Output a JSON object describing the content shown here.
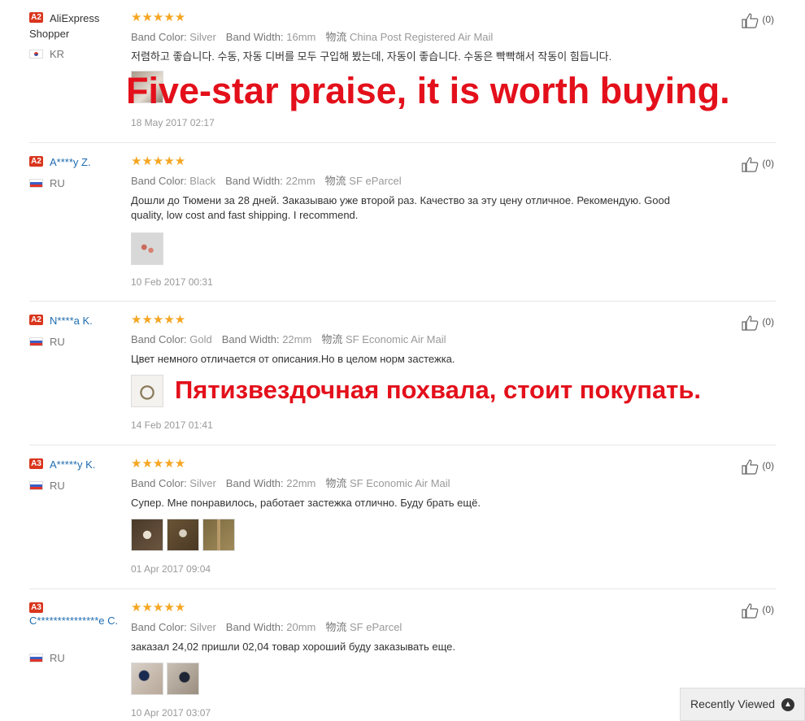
{
  "reviews": [
    {
      "level": "A2",
      "user": "AliExpress Shopper",
      "country_code": "kr",
      "country": "KR",
      "stars": "★★★★★",
      "band_color_label": "Band Color:",
      "band_color": "Silver",
      "band_width_label": "Band Width:",
      "band_width": "16mm",
      "shipping_label": "物流",
      "shipping": "China Post Registered Air Mail",
      "text": "저렴하고 좋습니다. 수동, 자동 디버를 모두 구입해 봤는데, 자동이 좋습니다. 수동은 빡빡해서 작동이 힘듭니다.",
      "thumbs": 1,
      "date": "18 May 2017 02:17",
      "helpful": "(0)"
    },
    {
      "level": "A2",
      "user": "A****y Z.",
      "country_code": "ru",
      "country": "RU",
      "stars": "★★★★★",
      "band_color_label": "Band Color:",
      "band_color": "Black",
      "band_width_label": "Band Width:",
      "band_width": "22mm",
      "shipping_label": "物流",
      "shipping": "SF eParcel",
      "text": "Дошли до Тюмени за 28 дней. Заказываю уже второй раз. Качество за эту цену отличное. Рекомендую. Good quality, low cost and fast shipping. I recommend.",
      "thumbs": 1,
      "date": "10 Feb 2017 00:31",
      "helpful": "(0)"
    },
    {
      "level": "A2",
      "user": "N****a K.",
      "country_code": "ru",
      "country": "RU",
      "stars": "★★★★★",
      "band_color_label": "Band Color:",
      "band_color": "Gold",
      "band_width_label": "Band Width:",
      "band_width": "22mm",
      "shipping_label": "物流",
      "shipping": "SF Economic Air Mail",
      "text": "Цвет немного отличается от описания.Но в целом норм застежка.",
      "thumbs": 1,
      "date": "14 Feb 2017 01:41",
      "helpful": "(0)"
    },
    {
      "level": "A3",
      "user": "A*****y K.",
      "country_code": "ru",
      "country": "RU",
      "stars": "★★★★★",
      "band_color_label": "Band Color:",
      "band_color": "Silver",
      "band_width_label": "Band Width:",
      "band_width": "22mm",
      "shipping_label": "物流",
      "shipping": "SF Economic Air Mail",
      "text": "Супер. Мне понравилось, работает застежка отлично. Буду брать ещё.",
      "thumbs": 3,
      "date": "01 Apr 2017 09:04",
      "helpful": "(0)"
    },
    {
      "level": "A3",
      "user": "C***************e C.",
      "country_code": "ru",
      "country": "RU",
      "stars": "★★★★★",
      "band_color_label": "Band Color:",
      "band_color": "Silver",
      "band_width_label": "Band Width:",
      "band_width": "20mm",
      "shipping_label": "物流",
      "shipping": "SF eParcel",
      "text": "заказал 24,02 пришли 02,04 товар хороший буду заказывать еще.",
      "thumbs": 2,
      "date": "10 Apr 2017 03:07",
      "helpful": "(0)"
    }
  ],
  "overlays": {
    "english": "Five-star praise, it is worth buying.",
    "russian": "Пятизвездочная похвала, стоит покупать."
  },
  "recently_viewed": "Recently Viewed",
  "colors": {
    "star": "#f5a623",
    "level_badge": "#d9361e",
    "link": "#1f6cb0",
    "overlay_red": "#e3101b"
  }
}
